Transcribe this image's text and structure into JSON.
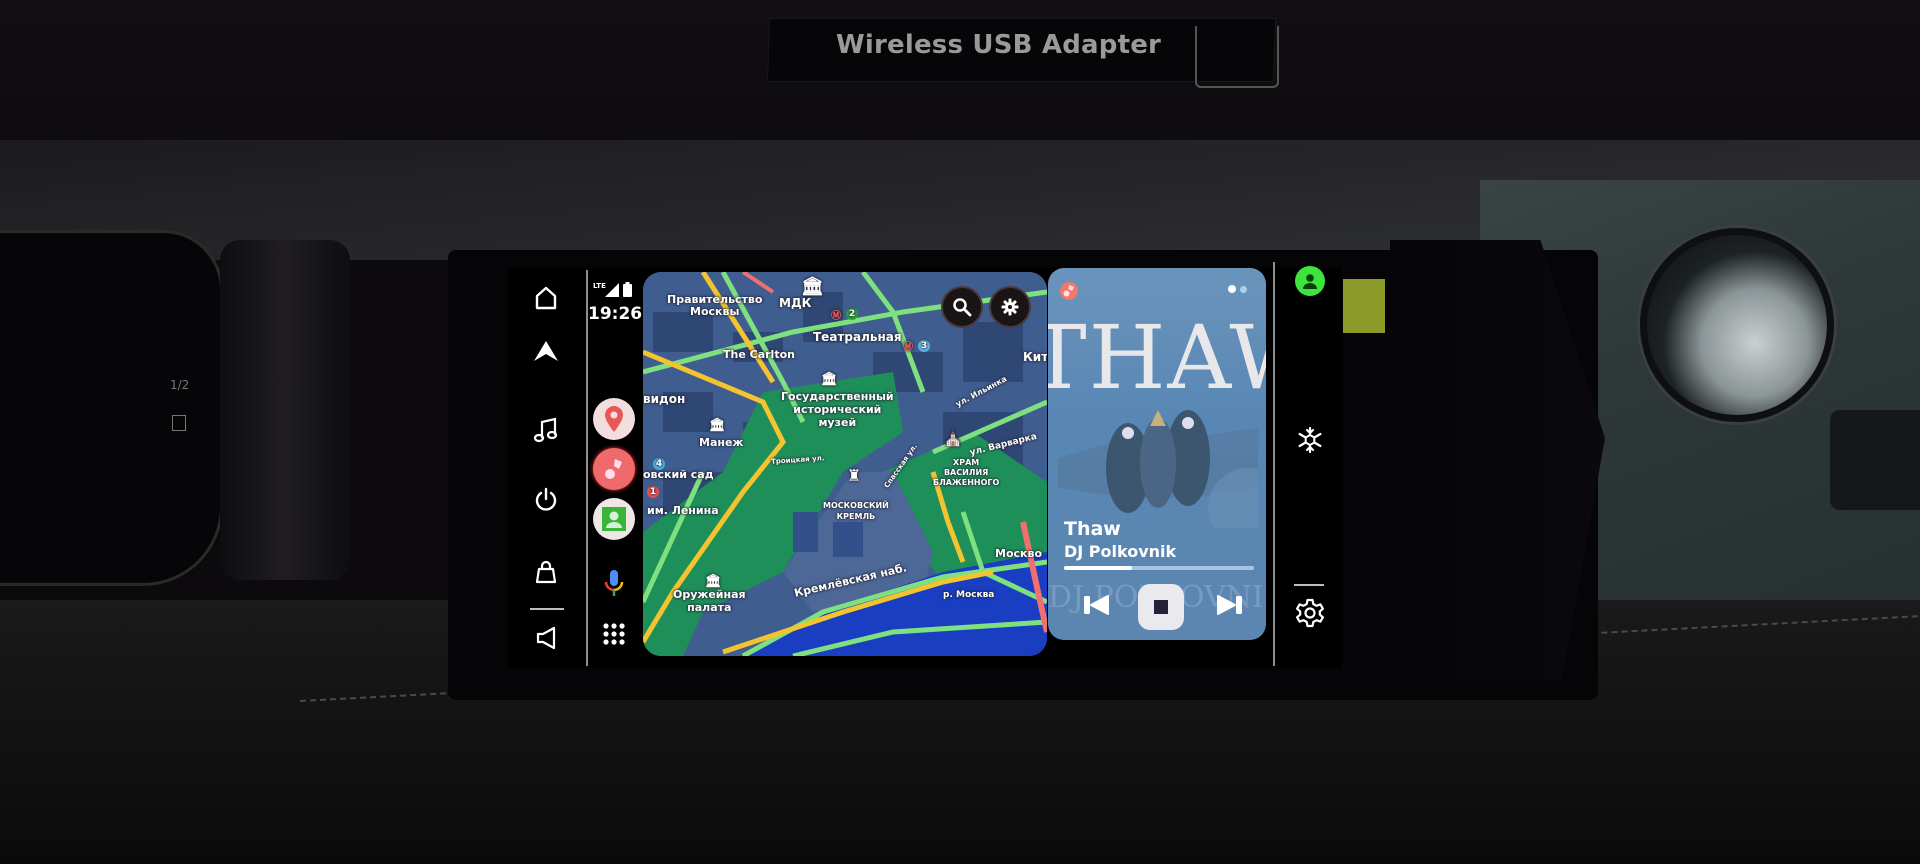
{
  "scene": {
    "adapter_label": "Wireless USB Adapter",
    "cluster_fuel_mark": "1/2"
  },
  "left_rail": {
    "items": [
      {
        "name": "home",
        "icon": "home-icon"
      },
      {
        "name": "navigation",
        "icon": "navigation-arrow-icon"
      },
      {
        "name": "music",
        "icon": "music-note-icon"
      },
      {
        "name": "power",
        "icon": "power-icon"
      },
      {
        "name": "shopping",
        "icon": "shopping-bag-icon"
      },
      {
        "name": "volume",
        "icon": "speaker-icon"
      }
    ]
  },
  "status": {
    "network": "LTE",
    "signal_icon": "signal-icon",
    "battery_icon": "battery-icon",
    "time": "19:26"
  },
  "app_dock": {
    "apps": [
      {
        "name": "maps",
        "icon": "map-pin-icon",
        "color": "#f2dede"
      },
      {
        "name": "music",
        "icon": "music-app-icon",
        "color": "#ef6b6b"
      },
      {
        "name": "contacts",
        "icon": "contact-icon",
        "color": "#f0e6e6"
      }
    ],
    "mic_icon": "microphone-icon",
    "grid_icon": "app-grid-icon"
  },
  "map": {
    "labels": {
      "pravitelstvo": "Правительство\nМосквы",
      "mdk": "МДК",
      "teatralnaya": "Театральная",
      "carlton": "The Carlton",
      "kit": "Кит",
      "vidon": "видон",
      "gim": "Государственный\nисторический\nмузей",
      "ilyinka": "ул. Ильинка",
      "manezh": "Манеж",
      "troitskaya": "Троицкая ул.",
      "sad": "овский сад",
      "spasskaya": "Спасская ул.",
      "khram": "ХРАМ\nВАСИЛИЯ\nБЛАЖЕННОГО",
      "varvarka": "ул. Варварка",
      "lenin": "им. Ленина",
      "kremlin": "МОСКОВСКИЙ\nКРЕМЛЬ",
      "oruzheynaya": "Оружейная\nпалата",
      "kremlevskaya": "Кремлёвская наб.",
      "moskvo": "Москво",
      "river": "р. Москва",
      "metro_2": "2",
      "metro_3": "3",
      "metro_1": "1",
      "metro_4": "4"
    },
    "search_icon": "search-icon",
    "settings_icon": "gear-icon"
  },
  "media": {
    "album_art_text": "THAW",
    "album_ghost_text": "DJ POLKOVNIK",
    "title": "Thaw",
    "artist": "DJ Polkovnik",
    "progress": 0.36,
    "page_dots": 2,
    "source_icon": "music-app-icon"
  },
  "right_rail": {
    "profile_icon": "user-icon",
    "climate_icon": "snowflake-icon",
    "settings_icon": "gear-icon",
    "profile_color": "#3ce43c"
  }
}
